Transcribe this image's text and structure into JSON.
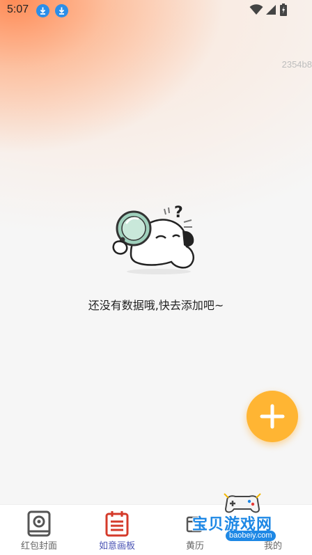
{
  "status_bar": {
    "time": "5:07",
    "icons": [
      "download-icon",
      "download-icon",
      "wifi-icon",
      "signal-icon",
      "battery-icon"
    ]
  },
  "corner_text": "2354b8",
  "empty_state": {
    "icon": "magnifier-character-illustration",
    "message": "还没有数据哦,快去添加吧~"
  },
  "fab": {
    "icon": "plus-icon",
    "color": "#ffb533"
  },
  "tab_bar": {
    "tabs": [
      {
        "label": "红包封面",
        "icon": "red-envelope-icon",
        "active": false
      },
      {
        "label": "如意画板",
        "icon": "calendar-board-icon",
        "active": true
      },
      {
        "label": "黄历",
        "icon": "almanac-icon",
        "active": false
      },
      {
        "label": "我的",
        "icon": "profile-icon",
        "active": false
      }
    ],
    "active_color": "#4a53b4"
  },
  "watermark": {
    "text": "宝贝游戏网",
    "url": "baobeiy.com"
  }
}
